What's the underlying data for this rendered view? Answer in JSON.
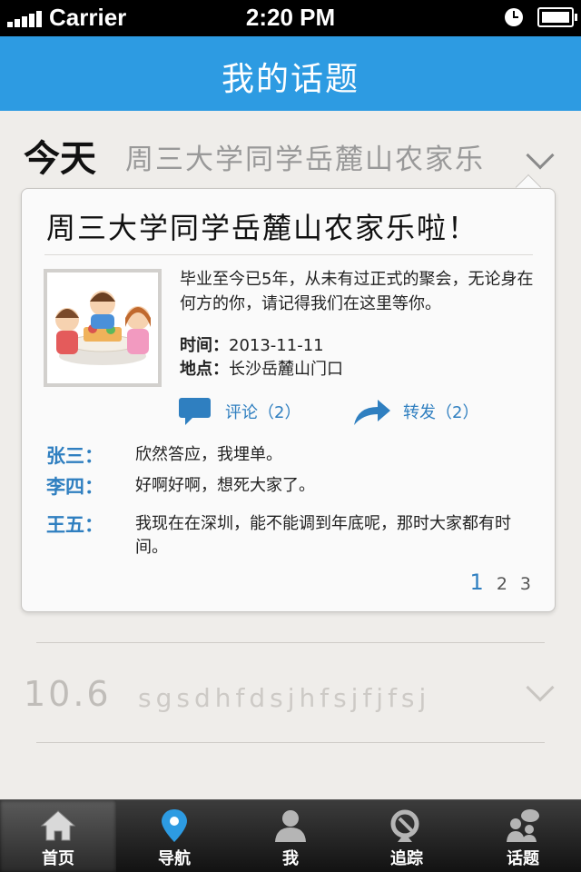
{
  "status_bar": {
    "carrier": "Carrier",
    "time": "2:20 PM"
  },
  "nav": {
    "title": "我的话题"
  },
  "rows": [
    {
      "date": "今天",
      "subject": "周三大学同学岳麓山农家乐"
    },
    {
      "date": "10.6",
      "subject": "sgsdhfdsjhfsjfjfsj"
    }
  ],
  "card": {
    "title": "周三大学同学岳麓山农家乐啦！",
    "description": "毕业至今已5年，从未有过正式的聚会，无论身在何方的你，请记得我们在这里等你。",
    "time_label": "时间：",
    "time_value": "2013-11-11",
    "location_label": "地点：",
    "location_value": "长沙岳麓山门口",
    "comment_action": "评论（2）",
    "forward_action": "转发（2）",
    "comments": [
      {
        "name": "张三：",
        "text": "欣然答应，我埋单。"
      },
      {
        "name": "李四：",
        "text": "好啊好啊，想死大家了。"
      },
      {
        "name": "王五：",
        "text": "我现在在深圳，能不能调到年底呢，那时大家都有时间。"
      }
    ],
    "pages": [
      "1",
      "2",
      "3"
    ],
    "current_page": "1"
  },
  "tabs": [
    {
      "label": "首页",
      "icon": "home-icon",
      "active": true
    },
    {
      "label": "导航",
      "icon": "map-pin-icon",
      "active": false
    },
    {
      "label": "我",
      "icon": "person-icon",
      "active": false
    },
    {
      "label": "追踪",
      "icon": "satellite-dish-icon",
      "active": false
    },
    {
      "label": "话题",
      "icon": "chat-people-icon",
      "active": false
    }
  ],
  "colors": {
    "nav_bar": "#2d9be2",
    "accent": "#2f7fc0",
    "tab_bar": "#1e1e1e",
    "background": "#efedea"
  }
}
